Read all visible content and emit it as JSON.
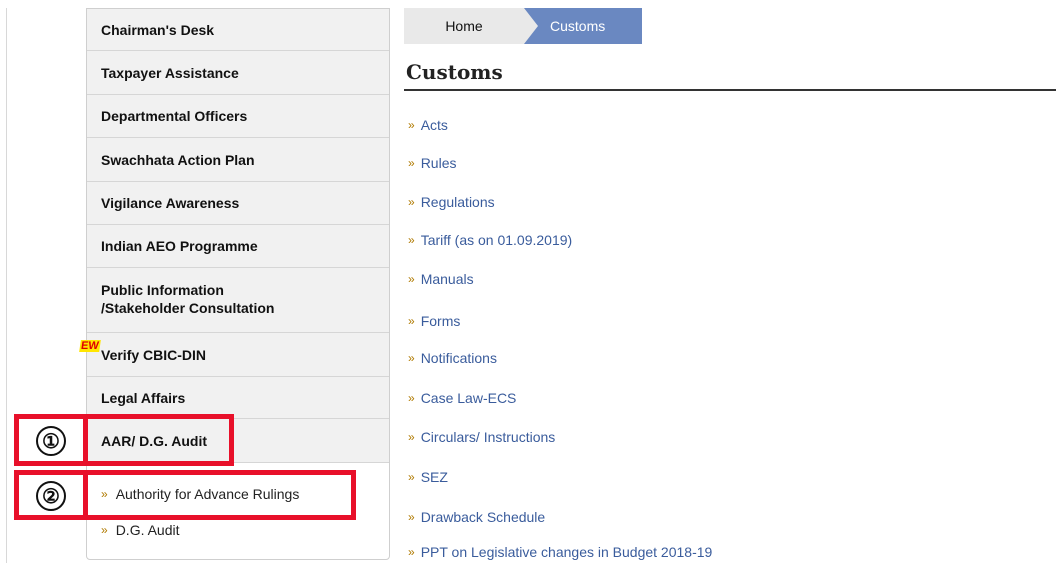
{
  "sidebar": {
    "items": [
      {
        "label": "Chairman's Desk"
      },
      {
        "label": "Taxpayer Assistance"
      },
      {
        "label": "Departmental Officers"
      },
      {
        "label": "Swachhata Action Plan"
      },
      {
        "label": "Vigilance Awareness"
      },
      {
        "label": "Indian AEO Programme"
      },
      {
        "label_line1": "Public Information",
        "label_line2": "/Stakeholder Consultation"
      },
      {
        "label": "Verify CBIC-DIN",
        "badge": "EW"
      },
      {
        "label": "Legal Affairs"
      },
      {
        "label": "AAR/ D.G. Audit"
      }
    ],
    "sub_items": [
      {
        "label": "Authority for Advance Rulings"
      },
      {
        "label": "D.G. Audit"
      }
    ]
  },
  "annotations": {
    "marker_1": "①",
    "marker_2": "②",
    "color": "#e8102a"
  },
  "breadcrumb": {
    "home": "Home",
    "current": "Customs",
    "current_color": "#6a88c1"
  },
  "main": {
    "title": "Customs",
    "link_bullet": "»",
    "links": [
      {
        "label": "Acts"
      },
      {
        "label": "Rules"
      },
      {
        "label": "Regulations"
      },
      {
        "label": "Tariff (as on 01.09.2019)"
      },
      {
        "label": "Manuals"
      },
      {
        "label": "Forms"
      },
      {
        "label": "Notifications"
      },
      {
        "label": "Case Law-ECS"
      },
      {
        "label": "Circulars/ Instructions"
      },
      {
        "label": "SEZ"
      },
      {
        "label": "Drawback Schedule"
      },
      {
        "label": "PPT on Legislative changes in Budget 2018-19"
      }
    ],
    "link_color": "#3a5c9c"
  }
}
